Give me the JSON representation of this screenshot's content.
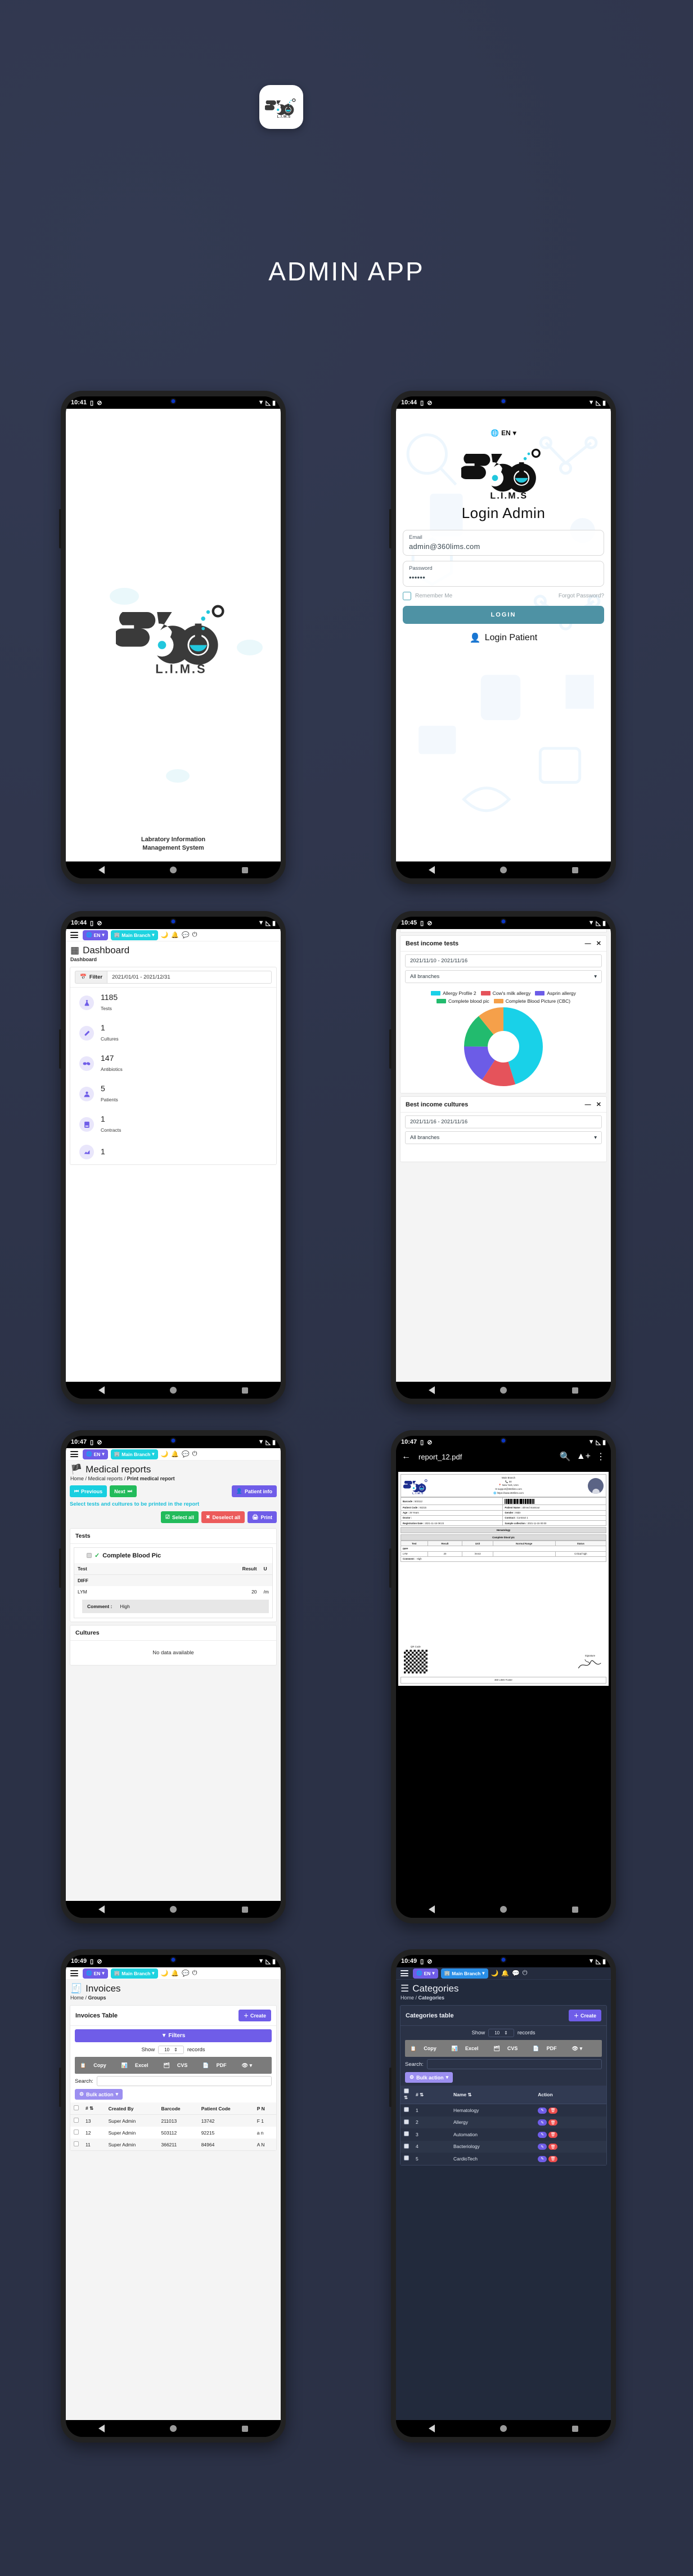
{
  "header": {
    "app_title": "ADMIN APP",
    "logo_text": "360",
    "logo_sub": "L.I.M.S"
  },
  "screens": {
    "splash": {
      "time": "10:41",
      "caption_line1": "Labratory Information",
      "caption_line2": "Management System"
    },
    "login": {
      "time": "10:44",
      "language": "EN",
      "title": "Login Admin",
      "email_label": "Email",
      "email_value": "admin@360lims.com",
      "password_label": "Password",
      "password_value": "••••••",
      "remember_label": "Remember Me",
      "forgot_label": "Forgot Password?",
      "login_button": "LOGIN",
      "login_patient": "Login Patient"
    },
    "dashboard": {
      "time": "10:44",
      "language": "EN",
      "branch": "Main Branch",
      "title": "Dashboard",
      "breadcrumb": "Dashboard",
      "filter_label": "Filter",
      "date_range": "2021/01/01 - 2021/12/31",
      "stats": [
        {
          "value": "1185",
          "label": "Tests",
          "icon": "flask-icon"
        },
        {
          "value": "1",
          "label": "Cultures",
          "icon": "test-tube-icon"
        },
        {
          "value": "147",
          "label": "Antibiotics",
          "icon": "pills-icon"
        },
        {
          "value": "5",
          "label": "Patients",
          "icon": "patient-icon"
        },
        {
          "value": "1",
          "label": "Contracts",
          "icon": "contract-icon"
        },
        {
          "value": "1",
          "label": "",
          "icon": "chart-icon"
        }
      ]
    },
    "charts": {
      "time": "10:45",
      "card1_title": "Best income tests",
      "card1_date": "2021/11/10 - 2021/11/16",
      "card1_branch": "All branches",
      "card2_title": "Best income cultures",
      "card2_date": "2021/11/16 - 2021/11/16",
      "card2_branch": "All branches"
    },
    "medical_reports": {
      "time": "10:47",
      "language": "EN",
      "branch": "Main Branch",
      "title": "Medical reports",
      "crumb_home": "Home",
      "crumb_mid": "Medical reports",
      "crumb_last": "Print medical report",
      "btn_previous": "Previous",
      "btn_next": "Next",
      "btn_patient_info": "Patient info",
      "hint": "Select tests and cultures to be printed in the report",
      "btn_select_all": "Select all",
      "btn_deselect_all": "Deselect all",
      "btn_print": "Print",
      "tests_header": "Tests",
      "test_group": "Complete Blood Pic",
      "columns": [
        "Test",
        "Result",
        "U"
      ],
      "rows": [
        {
          "test": "DIFF",
          "result": "",
          "unit": "",
          "group": true
        },
        {
          "test": "LYM",
          "result": "20",
          "unit": "/m",
          "group": false
        }
      ],
      "comment_label": "Comment :",
      "comment_value": "High",
      "cultures_header": "Cultures",
      "cultures_empty": "No data available"
    },
    "pdf": {
      "time": "10:47",
      "file_name": "report_12.pdf",
      "branch": "Main Branch",
      "phone": "00",
      "address": "New York, USA",
      "email": "support@360lims.com",
      "website": "https://www.360lims.com",
      "fields": [
        {
          "label": "Barcode :",
          "value": "503112"
        },
        {
          "label": "Patient Code :",
          "value": "92215"
        },
        {
          "label": "Patient Name :",
          "value": "ahmed mansour"
        },
        {
          "label": "Age :",
          "value": "29 Years"
        },
        {
          "label": "Gender :",
          "value": "Male"
        },
        {
          "label": "Doctor :",
          "value": ""
        },
        {
          "label": "Contract :",
          "value": "Contract 1"
        },
        {
          "label": "Registration Date :",
          "value": "2021-11-15 08:23"
        },
        {
          "label": "Sample collection :",
          "value": "2021-11-15 00:00"
        }
      ],
      "section_band": "Hematology",
      "test_band": "Complete blood pic",
      "columns": [
        "Test",
        "Result",
        "Unit",
        "Normal Range",
        "Status"
      ],
      "rows": [
        [
          "DIFF",
          "",
          "",
          "",
          ""
        ],
        [
          "LYM",
          "20",
          "/mm3",
          "",
          "Critical high"
        ]
      ],
      "comment_label": "Comment :",
      "comment_value": "High",
      "qr_label": "QR Code",
      "signature_label": "Signature",
      "footer": "360 LIMS Footer"
    },
    "invoices": {
      "time": "10:49",
      "language": "EN",
      "branch": "Main Branch",
      "title": "Invoices",
      "crumb_home": "Home",
      "crumb_last": "Groups",
      "table_title": "Invoices Table",
      "btn_create": "Create",
      "btn_filters": "Filters",
      "show_label": "Show",
      "show_value": "10",
      "records_label": "records",
      "export": [
        "Copy",
        "Excel",
        "CVS",
        "PDF"
      ],
      "search_label": "Search:",
      "bulk_action": "Bulk action",
      "columns": [
        "#",
        "Created By",
        "Barcode",
        "Patient Code",
        "P N"
      ],
      "rows": [
        {
          "num": "13",
          "created_by": "Super Admin",
          "barcode": "211013",
          "patient_code": "13742",
          "name": "F 1"
        },
        {
          "num": "12",
          "created_by": "Super Admin",
          "barcode": "503112",
          "patient_code": "92215",
          "name": "a n"
        },
        {
          "num": "11",
          "created_by": "Super Admin",
          "barcode": "366211",
          "patient_code": "84964",
          "name": "A N"
        }
      ]
    },
    "categories": {
      "time": "10:49",
      "language": "EN",
      "branch": "Main Branch",
      "title": "Categories",
      "crumb_home": "Home",
      "crumb_last": "Categories",
      "table_title": "Categories table",
      "btn_create": "Create",
      "show_label": "Show",
      "show_value": "10",
      "records_label": "records",
      "export": [
        "Copy",
        "Excel",
        "CVS",
        "PDF"
      ],
      "search_label": "Search:",
      "bulk_action": "Bulk action",
      "columns": [
        "#",
        "Name",
        "Action"
      ],
      "rows": [
        {
          "num": "1",
          "name": "Hematology"
        },
        {
          "num": "2",
          "name": "Allergy"
        },
        {
          "num": "3",
          "name": "Automation"
        },
        {
          "num": "4",
          "name": "Bacteriology"
        },
        {
          "num": "5",
          "name": "CardioTech"
        }
      ]
    }
  },
  "chart_data": {
    "type": "pie",
    "title": "Best income tests",
    "legend_position": "top",
    "labels": [
      "Allergy Profile 2",
      "Cow's milk allergy",
      "Asprin allergy",
      "Complete blood pic",
      "Complete Blood Picture (CBC)"
    ],
    "values": [
      45,
      14,
      16,
      14,
      11
    ],
    "colors": [
      "#19d1e8",
      "#e5535b",
      "#6c5ce7",
      "#22bb6e",
      "#f5a04a"
    ],
    "donut": true
  },
  "colors": {
    "page_bg": "#2b3146",
    "accent_purple": "#6f5de8",
    "accent_cyan": "#1fd3e0",
    "accent_teal": "#4e92a4",
    "danger": "#ef4d4d",
    "success": "#22bb5b"
  }
}
